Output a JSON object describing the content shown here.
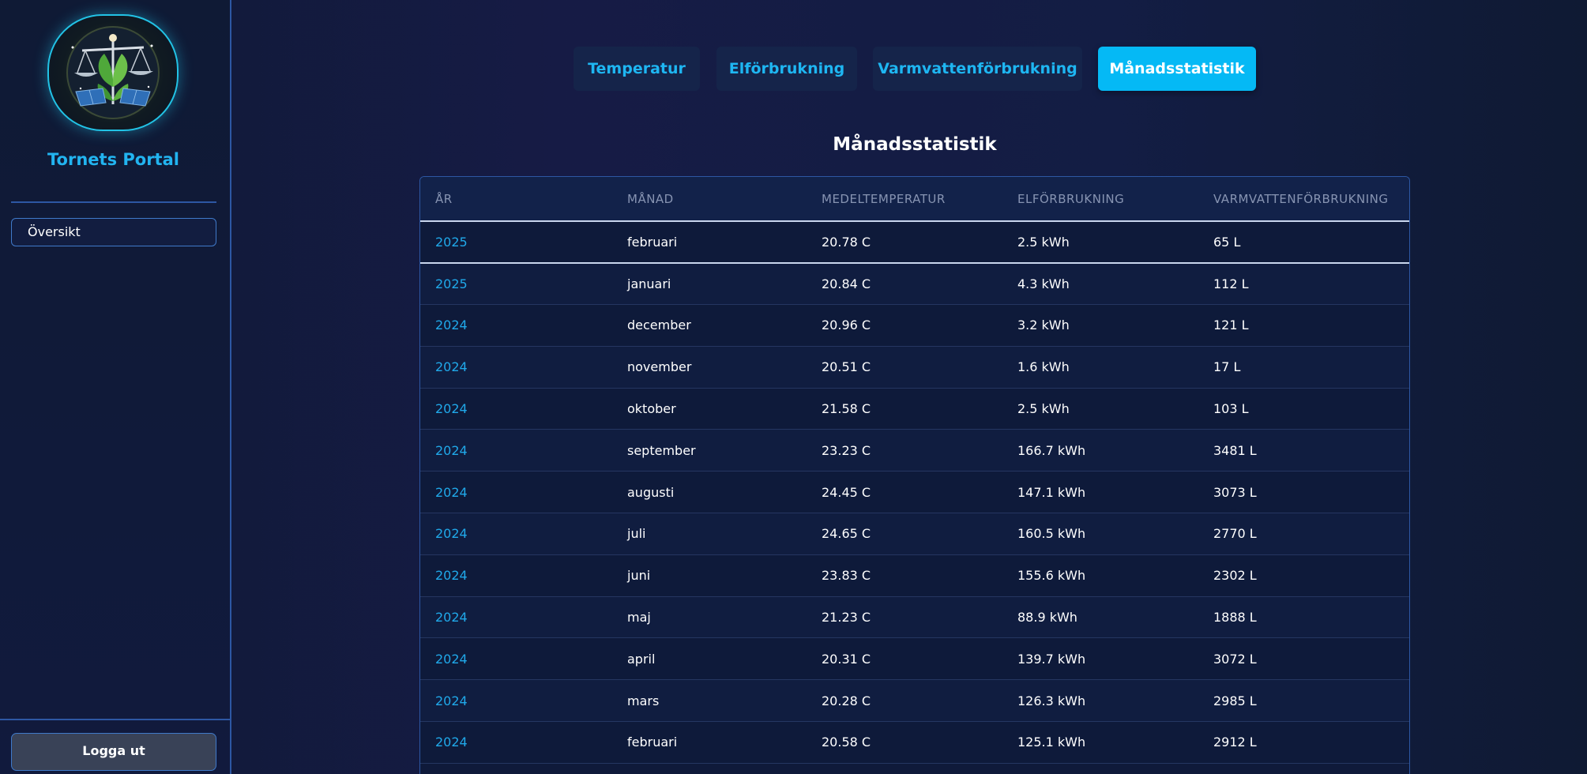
{
  "brand": {
    "name": "Tornets Portal"
  },
  "sidebar": {
    "items": [
      {
        "label": "Översikt"
      }
    ],
    "logout_label": "Logga ut"
  },
  "tabs": [
    {
      "label": "Temperatur",
      "active": false
    },
    {
      "label": "Elförbrukning",
      "active": false
    },
    {
      "label": "Varmvattenförbrukning",
      "active": false
    },
    {
      "label": "Månadsstatistik",
      "active": true
    }
  ],
  "main": {
    "title": "Månadsstatistik",
    "table": {
      "headers": [
        "ÅR",
        "MÅNAD",
        "MEDELTEMPERATUR",
        "ELFÖRBRUKNING",
        "VARMVATTENFÖRBRUKNING"
      ],
      "rows": [
        [
          "2025",
          "februari",
          "20.78 C",
          "2.5 kWh",
          "65 L"
        ],
        [
          "2025",
          "januari",
          "20.84 C",
          "4.3 kWh",
          "112 L"
        ],
        [
          "2024",
          "december",
          "20.96 C",
          "3.2 kWh",
          "121 L"
        ],
        [
          "2024",
          "november",
          "20.51 C",
          "1.6 kWh",
          "17 L"
        ],
        [
          "2024",
          "oktober",
          "21.58 C",
          "2.5 kWh",
          "103 L"
        ],
        [
          "2024",
          "september",
          "23.23 C",
          "166.7 kWh",
          "3481 L"
        ],
        [
          "2024",
          "augusti",
          "24.45 C",
          "147.1 kWh",
          "3073 L"
        ],
        [
          "2024",
          "juli",
          "24.65 C",
          "160.5 kWh",
          "2770 L"
        ],
        [
          "2024",
          "juni",
          "23.83 C",
          "155.6 kWh",
          "2302 L"
        ],
        [
          "2024",
          "maj",
          "21.23 C",
          "88.9 kWh",
          "1888 L"
        ],
        [
          "2024",
          "april",
          "20.31 C",
          "139.7 kWh",
          "3072 L"
        ],
        [
          "2024",
          "mars",
          "20.28 C",
          "126.3 kWh",
          "2985 L"
        ],
        [
          "2024",
          "februari",
          "20.58 C",
          "125.1 kWh",
          "2912 L"
        ]
      ]
    }
  },
  "colors": {
    "accent": "#05b9f5",
    "year_text": "#20a9ea",
    "border": "#2d57a3",
    "background": "#151c44"
  },
  "icons": {
    "logo": "scales-leaf-solar-emblem"
  }
}
